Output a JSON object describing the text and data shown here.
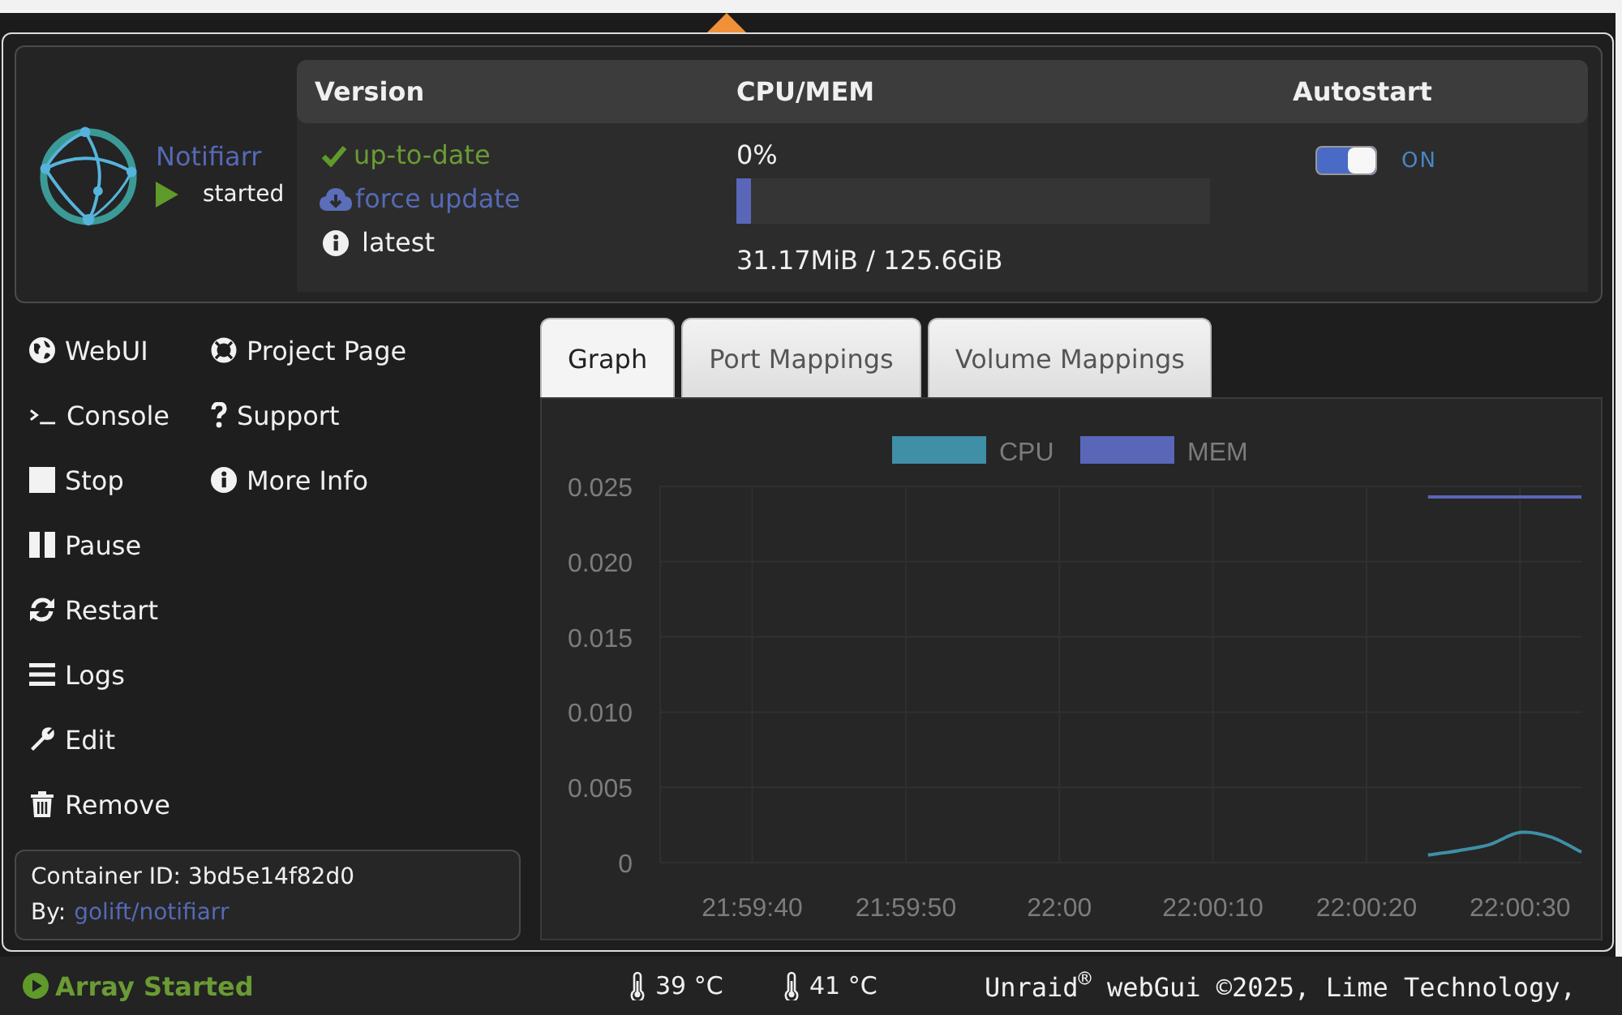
{
  "container": {
    "name": "Notifiarr",
    "status": "started"
  },
  "info_table": {
    "columns": [
      "Version",
      "CPU/MEM",
      "Autostart"
    ],
    "version": {
      "status": "up-to-date",
      "update_link": "force update",
      "tag": "latest"
    },
    "usage": {
      "cpu": "0%",
      "level": 0.03,
      "memory": "31.17MiB / 125.6GiB"
    },
    "autostart": {
      "on": true,
      "label": "ON"
    }
  },
  "actions": [
    {
      "kind": "webui",
      "label": "WebUI"
    },
    {
      "kind": "console",
      "label": "Console"
    },
    {
      "kind": "stop",
      "label": "Stop"
    },
    {
      "kind": "pause",
      "label": "Pause"
    },
    {
      "kind": "restart",
      "label": "Restart"
    },
    {
      "kind": "logs",
      "label": "Logs"
    },
    {
      "kind": "edit",
      "label": "Edit"
    },
    {
      "kind": "remove",
      "label": "Remove"
    }
  ],
  "links": [
    {
      "kind": "project",
      "label": "Project Page"
    },
    {
      "kind": "support",
      "label": "Support"
    },
    {
      "kind": "info",
      "label": "More Info"
    }
  ],
  "details": {
    "container_id": "Container ID: 3bd5e14f82d0",
    "author_label": "By:",
    "author": "golift/notifiarr"
  },
  "tabs": [
    {
      "label": "Graph",
      "selected": true
    },
    {
      "label": "Port Mappings",
      "selected": false
    },
    {
      "label": "Volume Mappings",
      "selected": false
    }
  ],
  "graph": {
    "chart_data": [
      {
        "type": "line",
        "x": [
          22.006667,
          22.007222,
          22.007778,
          22.008333,
          22.008889,
          22.009444
        ],
        "series": [
          {
            "name": "CPU",
            "color": "#3f8fa6",
            "values": [
              0.0005,
              0.0008,
              0.0012,
              0.002,
              0.0017,
              0.0007
            ]
          },
          {
            "name": "MEM",
            "color": "#5a66b8",
            "values": [
              0.0243,
              0.0243,
              0.0243,
              0.0243,
              0.0243,
              0.0243
            ]
          }
        ],
        "xlim": [
          21.992778,
          22.009444
        ],
        "ylim": [
          0,
          0.025
        ],
        "yticks": [
          {
            "value": 0,
            "label": "0"
          },
          {
            "value": 0.005,
            "label": "0.005"
          },
          {
            "value": 0.01,
            "label": "0.010"
          },
          {
            "value": 0.015,
            "label": "0.015"
          },
          {
            "value": 0.02,
            "label": "0.020"
          },
          {
            "value": 0.025,
            "label": "0.025"
          }
        ],
        "xticks": [
          {
            "value": 21.994444,
            "label": "21:59:40"
          },
          {
            "value": 21.997222,
            "label": "21:59:50"
          },
          {
            "value": 22,
            "label": "22:00"
          },
          {
            "value": 22.002778,
            "label": "22:00:10"
          },
          {
            "value": 22.005556,
            "label": "22:00:20"
          },
          {
            "value": 22.008333,
            "label": "22:00:30"
          }
        ],
        "legend": "top",
        "grid": true
      }
    ]
  },
  "status_bar": {
    "array": "Array Started",
    "temperatures": [
      "39 °C",
      "41 °C"
    ],
    "footer": "Unraid$^{®}$ webGui ©2025, Lime Technology,"
  }
}
